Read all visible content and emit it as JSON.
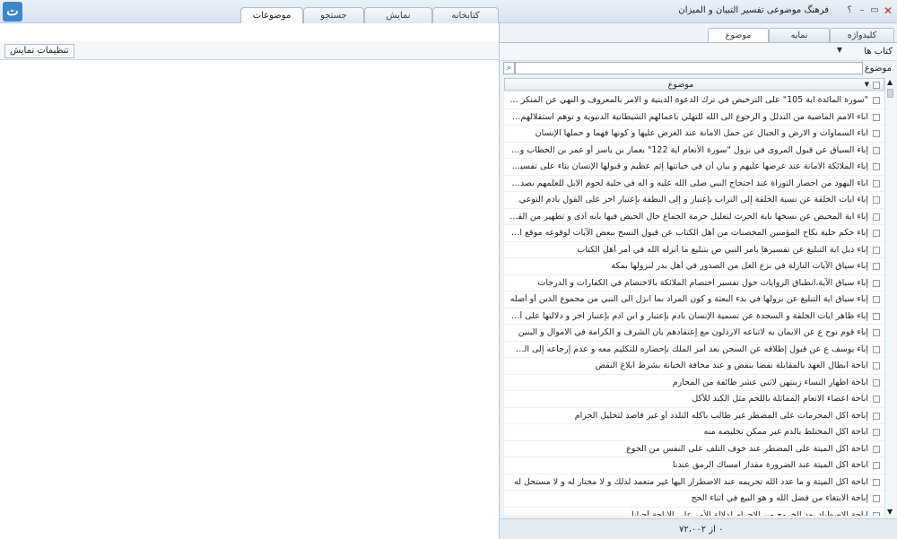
{
  "app": {
    "title": "فرهنگ موضوعی تفسیر التبیان و المیزان",
    "help_label": "؟",
    "minimize_label": "–",
    "restore_label": "▭",
    "close_label": "✕",
    "logo_text": "ت"
  },
  "main_tabs": [
    "موضوعات",
    "جستجو",
    "نمایش",
    "کتابخانه"
  ],
  "sub_tabs": [
    "کلیدواژه",
    "نمایه",
    "موضوع"
  ],
  "books_label": "کتاب ها",
  "topic_label": "موضوع",
  "search_input": {
    "value": "",
    "placeholder": ""
  },
  "list_header": "موضوع",
  "topics": [
    "\"سورة المائدة آية 105\" علی الترخيص في ترك الدعوة الدينية و الامر بالمعروف و النهي عن المنكر عند عدم الامن من الضرر ...",
    "اباء الامم الماضية من التذلل و الرجوع الى الله للتهلي باعمالهم الشيطانية الدنيوية و توهم استقلالهم في اصلاح الامور",
    "اباء السماوات و الارض و الجبال عن حمل الامانة عند العرض عليها و كونها فهما و حملها الإنسان",
    "إباء السياق عن قبول المروى في نزول \"سورة الأنعام آية 122\" بعمار بن ياسر أو عمر بن الخطاب و أبي جهل ابن هشام",
    "إباء الملائكة الامانة عند عرضها عليهم و بيان أن في خيانتها إثم عظيم و قبولها الإنسان بناء علی تفسير السماوات و الارض و...",
    "اباء اليهود من احضار التوراة عند احتجاج النبي صلى الله عليه و آله في حلية لحوم الابل للعلمهم بصدق النبي صلى الله عليه...",
    "إباء آيات الخلقة عن نسبة الخلقة إلى التراب بإعتبار و إلى النطفة بإعتبار آخر على القول بأدم النوعي",
    "إباء آية المحيض عن نسخها بآية الحرث لتعليل حرمة الجماع حال الحيض فيها بأنه أذى و تطهير من القذارة و عدم زوال هذ...",
    "إباء حكم حلية نكاح المؤمنين المحصنات من أهل الكتاب عن قبول النسخ ببعض الآيات لوقوعه موقع الامتنان و التخفيف",
    "إباء ذيل آية التبليغ عن تفسيرها بأمر النبي ص بتبليغ ما أنزله الله في أمر أهل الكتاب",
    "إباء سياق الآيات النازلة في نزع الغل من الصدور في أهل بدر لنزولها بمكة",
    "إباء سياق الآية،انطباق الروايات حول تفسير اختصام الملائكة بالاختصام في الكفارات و الدرجات",
    "إباء سياق آية التبليغ عن نزولها في بدء البعثة و كون المراد بما انزل الى النبي من مجموع الدين أو أصله",
    "إباء ظاهر آيات الخلقة و السجدة عن تسمية الإنسان بآدم بإعتبار و ابن آدم بإعتبار آخر و دلالتها على أن له شخصية مستقلة",
    "إباء قوم نوح ع عن الايمان به لاتباعه الارذلون مع إعتقادهم بأن الشرف و الكرامة في الاموال و البنين",
    "إباء يوسف ع عن قبول إطلاقه عن السجن بعد أمر الملك بإحضاره للتكليم معه و عدم إرجاعه إلى السجن ثانيا",
    "اباحة ابطال العهد بالمقابلة نقضا بنقض و عند مخافة الخيانة بشرط ابلاغ النقض",
    "اباحة اظهار النساء زينتهن لاثني عشر طائفة من المحارم",
    "اباحة اعضاء الانعام المماثلة باللحم مثل الكبد للأكل",
    "إباحة اكل المحرمات على المضطر غير طالب بأكله التلذذ أو غير قاصد لتحليل الحرام",
    "اباحة اكل المختلط بالدم غير ممكن تخليصه منه",
    "اباحة اكل الميتة على المضطر عند خوف التلف على النفس من الجوع",
    "اباحة اكل الميتة عند الضرورة مقدار امساك الرمق عندنا",
    "اباحة اكل الميتة و ما عدد الله تحريمه عند الاضطرار اليها غير متعمد لذلك و لا مختار له و لا مستحل له",
    "إباحة الابتغاء من فضل الله و هو البيع في أثناء الحج",
    "اباحة الاصطياد بعد الخروج من الاحرام لدلالة الأمر على الاباحة أحياناً"
  ],
  "status_text": "۰ از ۷۲،۰۰۲",
  "display_settings_label": "تنظیمات نمایش"
}
